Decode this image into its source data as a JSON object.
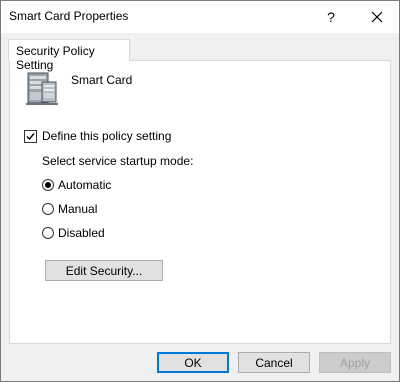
{
  "window": {
    "title": "Smart Card Properties",
    "help_label": "?"
  },
  "tabs": [
    {
      "label": "Security Policy Setting",
      "active": true
    }
  ],
  "service": {
    "name": "Smart Card",
    "icon": "server-icon"
  },
  "policy": {
    "define_label": "Define this policy setting",
    "define_checked": true,
    "startup_prompt": "Select service startup mode:",
    "options": [
      {
        "label": "Automatic",
        "selected": true
      },
      {
        "label": "Manual",
        "selected": false
      },
      {
        "label": "Disabled",
        "selected": false
      }
    ],
    "edit_security_label": "Edit Security..."
  },
  "buttons": {
    "ok": "OK",
    "cancel": "Cancel",
    "apply": "Apply",
    "apply_enabled": false
  },
  "colors": {
    "accent": "#0078d7",
    "dialog_bg": "#f0f0f0",
    "button_bg": "#e1e1e1"
  }
}
